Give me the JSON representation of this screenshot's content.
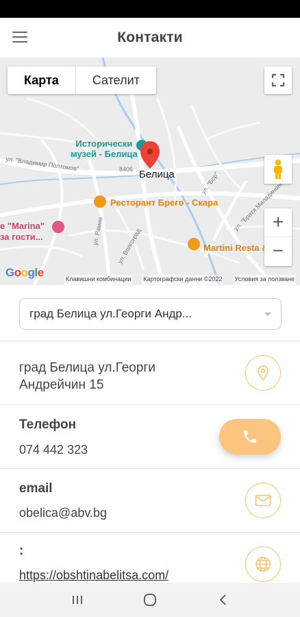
{
  "app_bar": {
    "title": "Контакти"
  },
  "map": {
    "type_tabs": {
      "map": "Карта",
      "satellite": "Сателит"
    },
    "labels": {
      "museum_line1": "Исторически",
      "museum_line2": "музей - Белица",
      "town": "Белица",
      "restaurant": "Ресторант Брего - Скара",
      "marina_line1": "е \"Marina\"",
      "marina_line2": "за гости...",
      "martini": "Martini Resta",
      "martini_amp": "&",
      "street_poltomov": "ул. \"Владимир Полтомов\"",
      "road_8406": "8406",
      "street_ramie": "ул. Рамие",
      "street_volgograd": "ул. Волгоград",
      "street_bratya": "ул. \"Братя Миладинови\"",
      "street_bor": "ул. \"Бор\""
    },
    "footer": {
      "shortcuts": "Клавишни комбинации",
      "map_data": "Картографски данни ©2022",
      "terms": "Условия за ползване"
    },
    "logo": "Google",
    "zoom_in": "+",
    "zoom_out": "−",
    "colors": {
      "teal": "#1a9a96",
      "orange": "#e8840b",
      "pink": "#d4426b",
      "pin": "#ea4335"
    }
  },
  "address_select": {
    "selected": "град Белица ул.Георги Андр..."
  },
  "address": {
    "line1": "град Белица ул.Георги",
    "line2": "Андрейчин 15",
    "icon": "location-pin-icon"
  },
  "phone": {
    "label": "Телефон",
    "value": "074 442 323",
    "icon": "phone-icon"
  },
  "email": {
    "label": "email",
    "value": "obelica@abv.bg",
    "icon": "mail-icon"
  },
  "website": {
    "label": ":",
    "value": "https://obshtinabelitsa.com/",
    "icon": "globe-icon"
  },
  "accent_color": "#f5c56d",
  "fab_color": "#fcc57f"
}
